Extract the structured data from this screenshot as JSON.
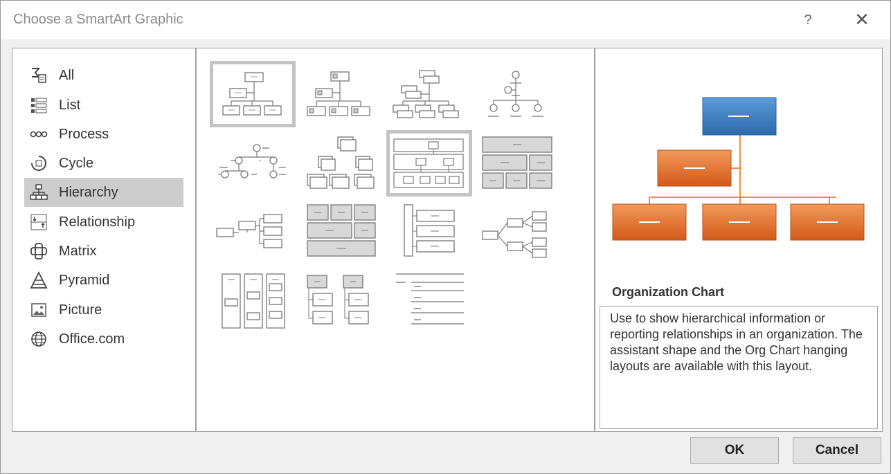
{
  "window": {
    "title": "Choose a SmartArt Graphic",
    "help_label": "?",
    "close_label": "✕"
  },
  "categories": [
    {
      "label": "All",
      "icon": "all-icon"
    },
    {
      "label": "List",
      "icon": "list-icon"
    },
    {
      "label": "Process",
      "icon": "process-icon"
    },
    {
      "label": "Cycle",
      "icon": "cycle-icon"
    },
    {
      "label": "Hierarchy",
      "icon": "hierarchy-icon",
      "selected": true
    },
    {
      "label": "Relationship",
      "icon": "relationship-icon"
    },
    {
      "label": "Matrix",
      "icon": "matrix-icon"
    },
    {
      "label": "Pyramid",
      "icon": "pyramid-icon"
    },
    {
      "label": "Picture",
      "icon": "picture-icon"
    },
    {
      "label": "Office.com",
      "icon": "globe-icon"
    }
  ],
  "gallery": {
    "selected_layout": "Organization Chart",
    "layout_count": 15
  },
  "preview": {
    "layout_name": "Organization Chart",
    "description": "Use to show hierarchical information or reporting relationships in an organization. The assistant shape and the Org Chart hanging layouts are available with this layout.",
    "colors": {
      "top_box": "#3a7dc0",
      "child_boxes": "#e2681a",
      "connector": "#f08a4a"
    }
  },
  "buttons": {
    "ok": "OK",
    "cancel": "Cancel"
  }
}
